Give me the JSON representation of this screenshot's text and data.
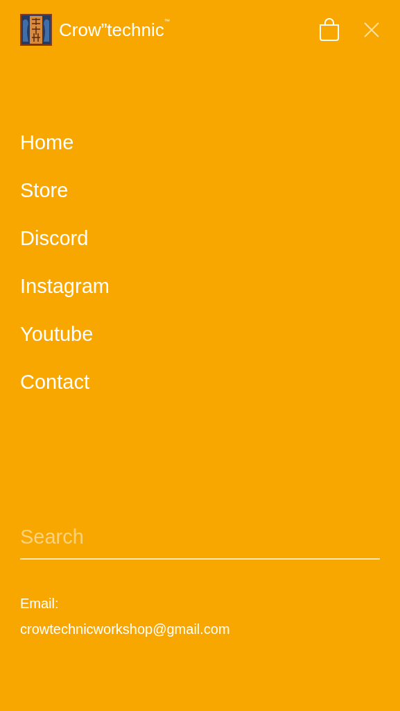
{
  "header": {
    "brand": "Crow”technic$^{™}$"
  },
  "nav": {
    "items": [
      "Home",
      "Store",
      "Discord",
      "Instagram",
      "Youtube",
      "Contact"
    ]
  },
  "search": {
    "placeholder": "Search"
  },
  "contact": {
    "label": "Email:",
    "email": "crowtechnicworkshop@gmail.com"
  }
}
